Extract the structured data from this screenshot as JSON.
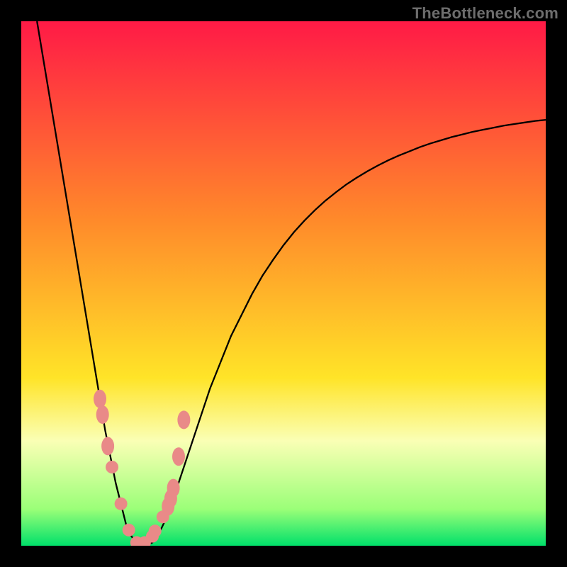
{
  "watermark": {
    "text": "TheBottleneck.com"
  },
  "gradient": {
    "top_color": "#ff1a46",
    "mid1_color": "#ff8a2a",
    "mid2_color": "#ffe428",
    "pale_color": "#faffb5",
    "near_bottom": "#9bff78",
    "bottom_color": "#00e06a"
  },
  "curve": {
    "stroke": "#000000",
    "stroke_width": 2.3
  },
  "marker": {
    "fill": "#e98a88",
    "radius": 9,
    "stretch_radius_y": 13
  },
  "chart_data": {
    "type": "line",
    "title": "",
    "xlabel": "",
    "ylabel": "",
    "xlim": [
      0,
      100
    ],
    "ylim": [
      0,
      100
    ],
    "x": [
      3,
      4,
      5,
      6,
      7,
      8,
      9,
      10,
      11,
      12,
      13,
      14,
      15,
      16,
      17,
      18,
      19,
      20,
      21,
      22,
      23,
      24,
      25,
      26,
      28,
      30,
      32,
      34,
      36,
      38,
      40,
      42,
      44,
      46,
      48,
      50,
      52,
      54,
      56,
      58,
      60,
      62,
      64,
      66,
      68,
      70,
      72,
      74,
      76,
      78,
      80,
      82,
      84,
      86,
      88,
      90,
      92,
      94,
      96,
      98,
      100
    ],
    "values": [
      100,
      94,
      88,
      82,
      76,
      70,
      64,
      58,
      52,
      46,
      40,
      34,
      28,
      22,
      17,
      12,
      8,
      4,
      1.8,
      0.6,
      0.2,
      0.2,
      0.6,
      1.8,
      6,
      12,
      18,
      24,
      30,
      35,
      40,
      44,
      48,
      51.5,
      54.5,
      57.3,
      59.8,
      62,
      64,
      65.8,
      67.4,
      68.9,
      70.2,
      71.4,
      72.5,
      73.5,
      74.4,
      75.2,
      76,
      76.7,
      77.3,
      77.9,
      78.4,
      78.9,
      79.3,
      79.7,
      80.1,
      80.4,
      80.7,
      81,
      81.2
    ],
    "marker_x": [
      15.0,
      15.5,
      16.5,
      17.3,
      19.0,
      20.5,
      22.0,
      23.5,
      25.0,
      25.5,
      27.0,
      28.0,
      28.5,
      29.0,
      30.0,
      31.0
    ],
    "marker_values": [
      28.0,
      25.0,
      19.0,
      15.0,
      8.0,
      3.0,
      0.6,
      0.6,
      1.8,
      2.8,
      5.5,
      7.5,
      9.0,
      11.0,
      17.0,
      24.0
    ],
    "marker_stretch": [
      true,
      true,
      true,
      false,
      false,
      false,
      false,
      false,
      false,
      false,
      false,
      true,
      true,
      true,
      true,
      true
    ],
    "grid": false,
    "legend": false
  }
}
